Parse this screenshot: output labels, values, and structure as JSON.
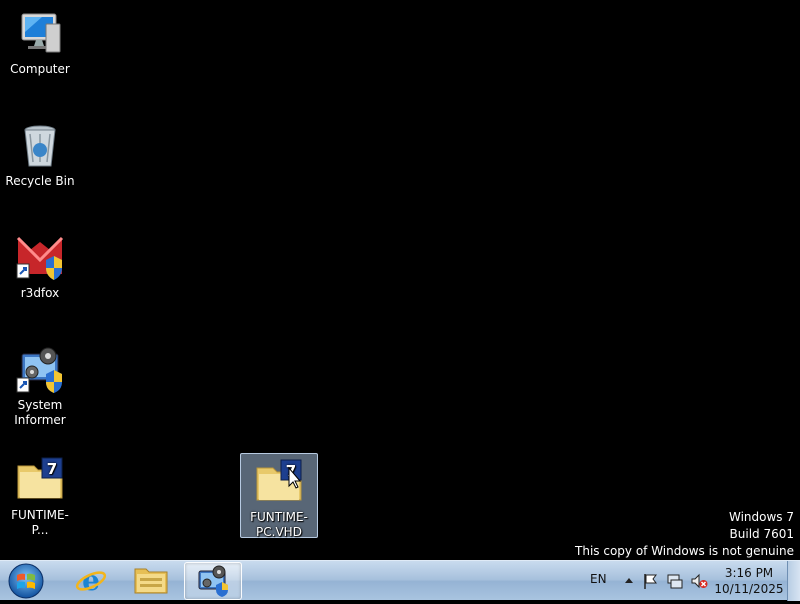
{
  "desktop": {
    "icons": [
      {
        "label": "Computer",
        "icon": "computer-icon"
      },
      {
        "label": "Recycle Bin",
        "icon": "recycle-bin-icon"
      },
      {
        "label": "r3dfox",
        "icon": "r3dfox-icon"
      },
      {
        "label": "System Informer",
        "icon": "system-informer-icon"
      },
      {
        "label": "FUNTIME-P...",
        "icon": "vhd-folder-icon"
      },
      {
        "label": "FUNTIME-PC.VHD",
        "icon": "vhd-folder-icon",
        "selected": true
      }
    ]
  },
  "watermark": {
    "line1": "Windows 7",
    "line2": "Build 7601",
    "line3": "This copy of Windows is not genuine"
  },
  "taskbar": {
    "start_icon": "windows-start-orb",
    "pinned": [
      {
        "name": "Internet Explorer",
        "icon": "ie-icon"
      },
      {
        "name": "Windows Explorer",
        "icon": "explorer-folder-icon"
      },
      {
        "name": "System Informer",
        "icon": "system-informer-icon",
        "active": true
      }
    ],
    "tray": {
      "language": "EN",
      "time": "3:16 PM",
      "date": "10/11/2025",
      "icons": [
        "show-hidden-arrow-icon",
        "action-center-flag-icon",
        "network-icon",
        "volume-muted-icon"
      ]
    }
  },
  "colors": {
    "desktop_bg": "#000000",
    "taskbar": "#a6c0dc",
    "selection": "#a0b9d7"
  }
}
